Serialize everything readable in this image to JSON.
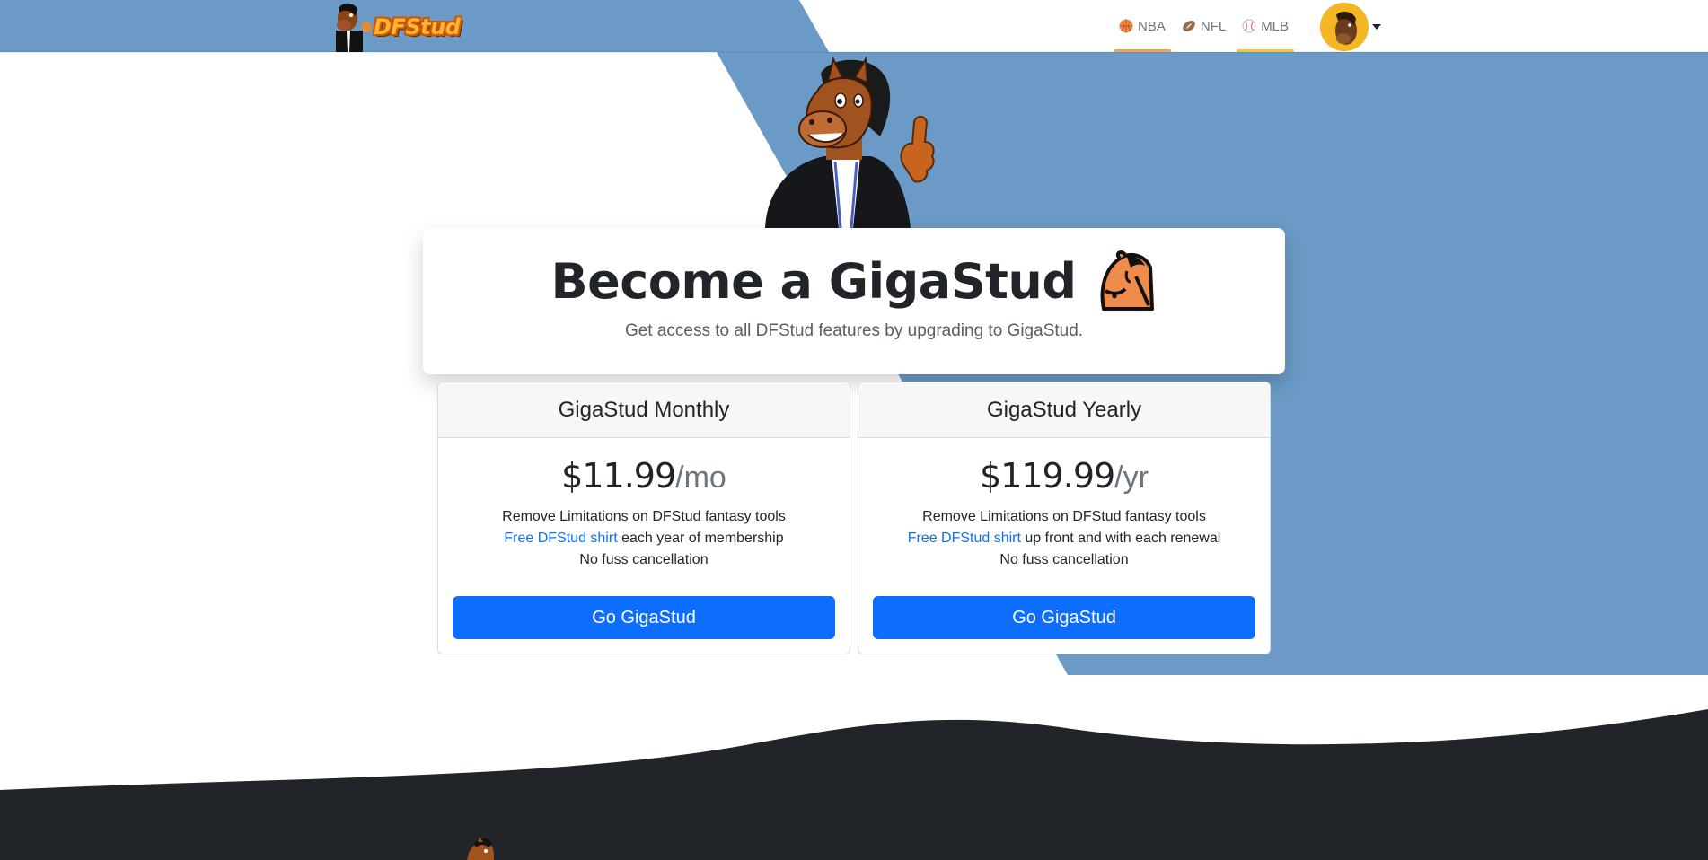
{
  "navbar": {
    "brand": {
      "name": "DFStud"
    },
    "links": [
      {
        "label": "NBA",
        "icon": "basketball-icon",
        "color": "#f08c4b"
      },
      {
        "label": "NFL",
        "icon": "football-icon",
        "color": "#9b6b4d"
      },
      {
        "label": "MLB",
        "icon": "baseball-icon",
        "color": "#d9534f"
      }
    ],
    "avatar": {
      "icon": "horse-avatar-icon"
    }
  },
  "hero": {
    "title": "Become a GigaStud",
    "emoji": "horse-emoji-icon",
    "subtitle": "Get access to all DFStud features by upgrading to GigaStud."
  },
  "plans": [
    {
      "name": "GigaStud Monthly",
      "price": "$11.99",
      "period": "/mo",
      "features": [
        {
          "text": "Remove Limitations on DFStud fantasy tools"
        },
        {
          "link": "Free DFStud shirt",
          "text": " each year of membership"
        },
        {
          "text": "No fuss cancellation"
        }
      ],
      "button": "Go GigaStud"
    },
    {
      "name": "GigaStud Yearly",
      "price": "$119.99",
      "period": "/yr",
      "features": [
        {
          "text": "Remove Limitations on DFStud fantasy tools"
        },
        {
          "link": "Free DFStud shirt",
          "text": " up front and with each renewal"
        },
        {
          "text": "No fuss cancellation"
        }
      ],
      "button": "Go GigaStud"
    }
  ],
  "colors": {
    "accent_blue": "#6a9ac5",
    "button_blue": "#0d6efd",
    "footer_dark": "#212529",
    "nav_underline": "#f5a34a"
  }
}
